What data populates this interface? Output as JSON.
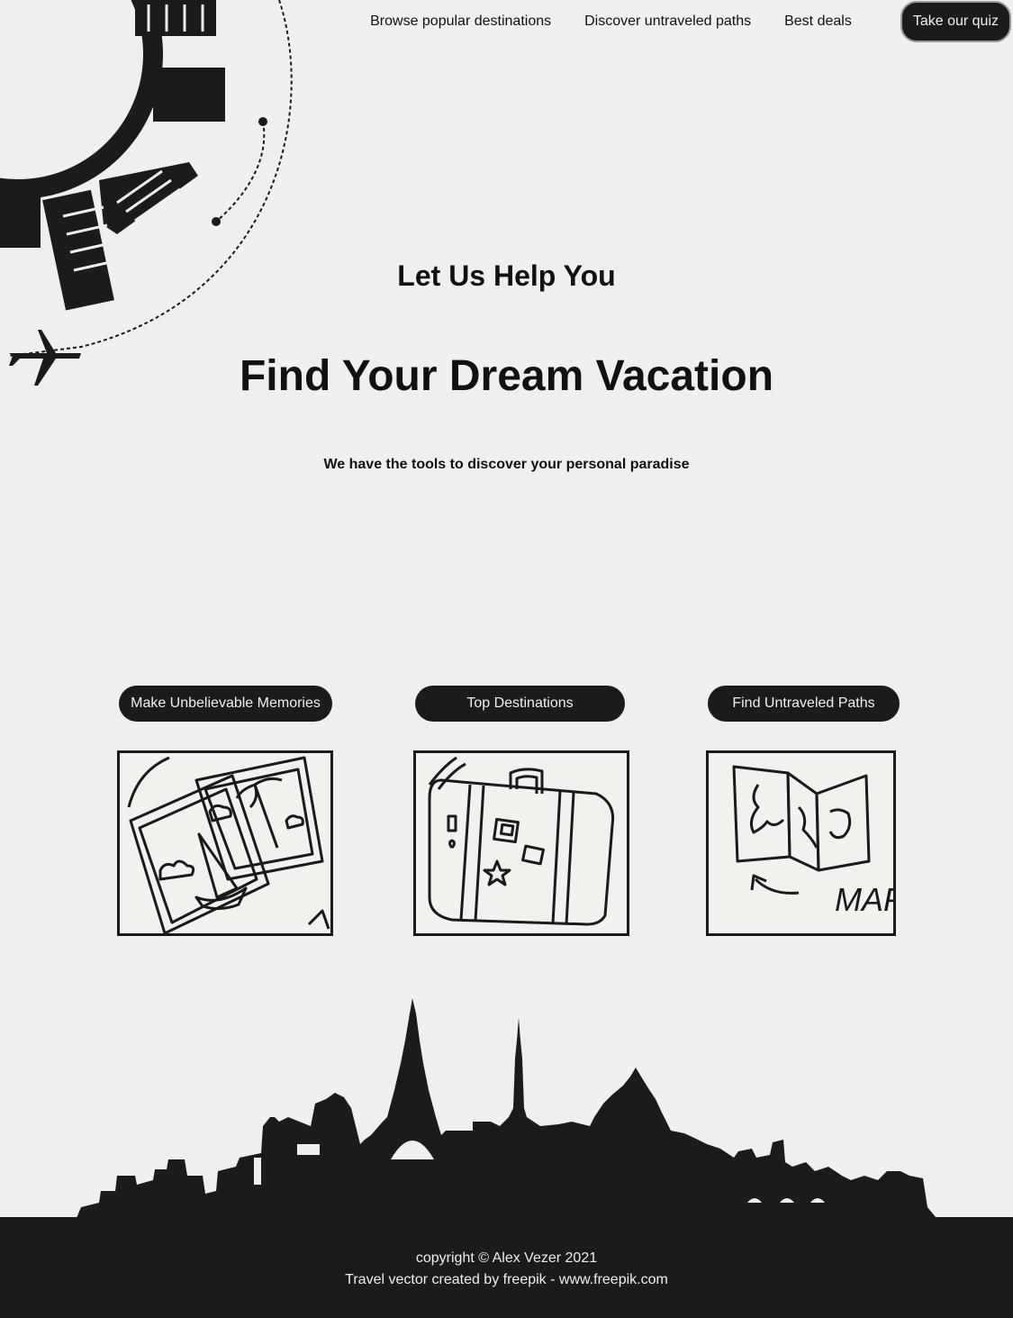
{
  "nav": {
    "links": [
      "Browse popular destinations",
      "Discover untraveled paths",
      "Best deals"
    ],
    "quiz_label": "Take our quiz"
  },
  "hero": {
    "subtitle": "Let Us Help You",
    "title": "Find Your Dream Vacation",
    "tagline": "We have the tools to discover your personal paradise"
  },
  "features": [
    {
      "label": "Make Unbelievable Memories",
      "icon": "photos-icon"
    },
    {
      "label": "Top Destinations",
      "icon": "suitcase-icon"
    },
    {
      "label": "Find Untraveled Paths",
      "icon": "map-icon"
    }
  ],
  "card_text": {
    "map": "MAP"
  },
  "footer": {
    "copyright": "copyright © Alex Vezer 2021",
    "credit": "Travel vector created by freepik - www.freepik.com"
  },
  "colors": {
    "dark": "#1a1c1c",
    "background": "#eef0ef"
  }
}
